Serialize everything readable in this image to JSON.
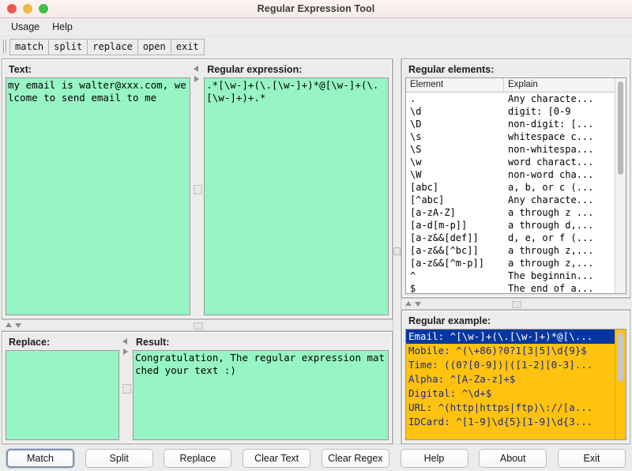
{
  "window": {
    "title": "Regular Expression Tool",
    "traffic_lights": [
      "close-red",
      "minimize-yellow",
      "maximize-green"
    ]
  },
  "menubar": {
    "items": [
      {
        "label": "Usage"
      },
      {
        "label": "Help"
      }
    ]
  },
  "toolbar": {
    "buttons": [
      {
        "label": "match"
      },
      {
        "label": "split"
      },
      {
        "label": "replace"
      },
      {
        "label": "open"
      },
      {
        "label": "exit"
      }
    ]
  },
  "text_panel": {
    "label": "Text:",
    "value": "my email is walter@xxx.com, welcome to send email to me",
    "placeholder": ""
  },
  "regex_panel": {
    "label": "Regular expression:",
    "value": ".*[\\w-]+(\\.[\\w-]+)*@[\\w-]+(\\.[\\w-]+)+.*",
    "placeholder": ""
  },
  "replace_panel": {
    "label": "Replace:",
    "value": "",
    "placeholder": ""
  },
  "result_panel": {
    "label": "Result:",
    "value": "Congratulation, The regular expression matched your text :)",
    "placeholder": ""
  },
  "elements_panel": {
    "label": "Regular elements:",
    "columns": [
      "Element",
      "Explain"
    ],
    "rows": [
      {
        "element": ".",
        "explain": "Any characte..."
      },
      {
        "element": "\\d",
        "explain": "digit: [0-9"
      },
      {
        "element": "\\D",
        "explain": "non-digit: [..."
      },
      {
        "element": "\\s",
        "explain": "whitespace c..."
      },
      {
        "element": "\\S",
        "explain": "non-whitespa..."
      },
      {
        "element": "\\w",
        "explain": "word charact..."
      },
      {
        "element": "\\W",
        "explain": "non-word cha..."
      },
      {
        "element": "[abc]",
        "explain": "a, b, or c (..."
      },
      {
        "element": "[^abc]",
        "explain": "Any characte..."
      },
      {
        "element": "[a-zA-Z]",
        "explain": "a through z ..."
      },
      {
        "element": "[a-d[m-p]]",
        "explain": "a through d,..."
      },
      {
        "element": "[a-z&&[def]]",
        "explain": "d, e, or f (..."
      },
      {
        "element": "[a-z&&[^bc]]",
        "explain": "a through z,..."
      },
      {
        "element": "[a-z&&[^m-p]]",
        "explain": "a through z,..."
      },
      {
        "element": "^",
        "explain": "The beginnin..."
      },
      {
        "element": "$",
        "explain": "The end of a..."
      }
    ]
  },
  "examples_panel": {
    "label": "Regular example:",
    "selected_index": 0,
    "rows": [
      {
        "text": "Email: ^[\\w-]+(\\.[\\w-]+)*@[\\..."
      },
      {
        "text": "Mobile: ^(\\+86)?0?1[3|5]\\d{9}$"
      },
      {
        "text": "Time: ((0?[0-9])|([1-2][0-3]..."
      },
      {
        "text": "Alpha: ^[A-Za-z]+$"
      },
      {
        "text": "Digital: ^\\d+$"
      },
      {
        "text": "URL: ^(http|https|ftp)\\://[a..."
      },
      {
        "text": "IDCard: ^[1-9]\\d{5}[1-9]\\d{3..."
      }
    ]
  },
  "buttonbar": {
    "buttons": [
      {
        "label": "Match",
        "focused": true
      },
      {
        "label": "Split",
        "focused": false
      },
      {
        "label": "Replace",
        "focused": false
      },
      {
        "label": "Clear Text",
        "focused": false
      },
      {
        "label": "Clear Regex",
        "focused": false
      },
      {
        "label": "Help",
        "focused": false
      },
      {
        "label": "About",
        "focused": false
      },
      {
        "label": "Exit",
        "focused": false
      }
    ]
  },
  "colors": {
    "textarea_bg": "#97f5c4",
    "example_bg": "#ffc20e",
    "example_selected_bg": "#0537a0",
    "example_text": "#1a2a8a",
    "window_bg": "#ececec"
  }
}
